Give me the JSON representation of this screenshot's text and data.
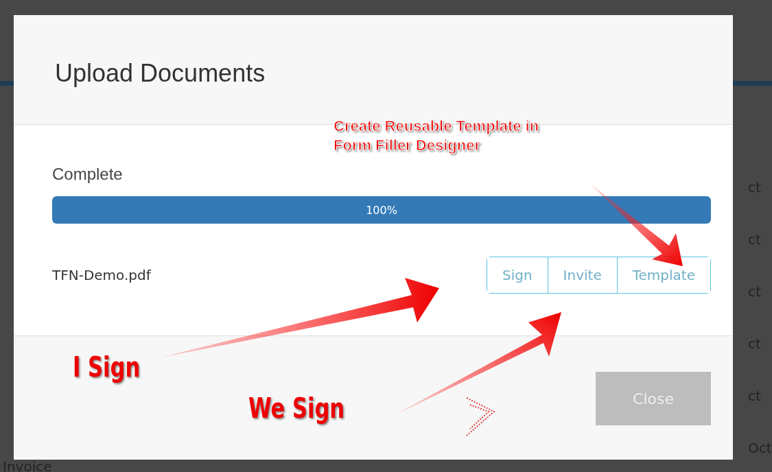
{
  "background": {
    "row_texts": [
      "ct",
      "ct",
      "ct",
      "ct",
      "ct",
      "Oct"
    ],
    "bottom_left_text": "Invoice"
  },
  "dialog": {
    "title": "Upload Documents",
    "status": "Complete",
    "progress": {
      "level": 1,
      "reading": "100%"
    },
    "file": {
      "name": "TFN-Demo.pdf",
      "actions": [
        "Sign",
        "Invite",
        "Template"
      ]
    },
    "close_button": {
      "label": "Close",
      "disabled": true
    }
  },
  "annotations": [
    {
      "lines": [
        "Create Reusable Template in",
        "Form Filler Designer"
      ]
    },
    {
      "lines": [
        "I Sign"
      ]
    },
    {
      "lines": [
        "We Sign"
      ]
    }
  ]
}
